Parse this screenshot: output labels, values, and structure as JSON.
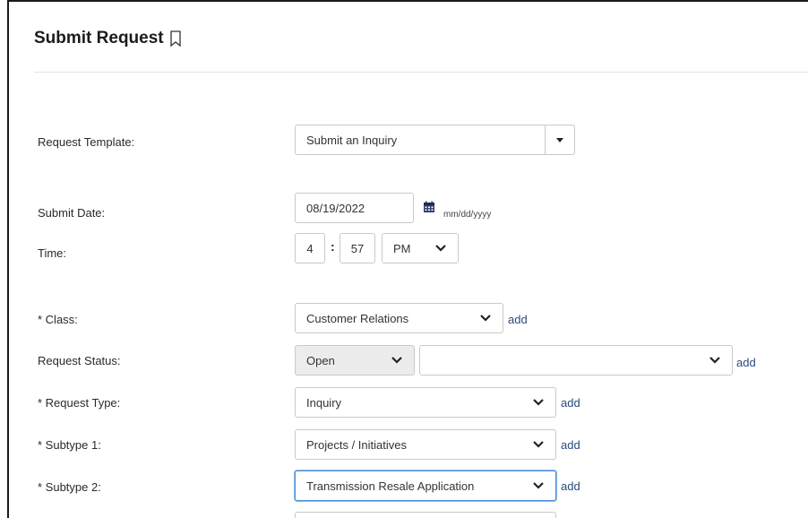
{
  "header": {
    "title": "Submit Request",
    "bookmark_icon": "bookmark-outline-icon"
  },
  "form": {
    "request_template": {
      "label": "Request Template:",
      "value": "Submit an Inquiry"
    },
    "submit_date": {
      "label": "Submit Date:",
      "value": "08/19/2022",
      "format_hint": "mm/dd/yyyy"
    },
    "time": {
      "label": "Time:",
      "hour": "4",
      "minute": "57",
      "ampm": "PM"
    },
    "class": {
      "label": "* Class:",
      "value": "Customer Relations",
      "add_label": "add"
    },
    "request_status": {
      "label": "Request Status:",
      "status": "Open",
      "secondary": "",
      "add_label": "add"
    },
    "request_type": {
      "label": "* Request Type:",
      "value": "Inquiry",
      "add_label": "add"
    },
    "subtype1": {
      "label": "* Subtype 1:",
      "value": "Projects / Initiatives",
      "add_label": "add"
    },
    "subtype2": {
      "label": "* Subtype 2:",
      "value": "Transmission Resale Application",
      "add_label": "add"
    }
  },
  "colors": {
    "accent": "#4a90d9",
    "link": "#2b4a7a",
    "calendar": "#2f3f6b"
  }
}
